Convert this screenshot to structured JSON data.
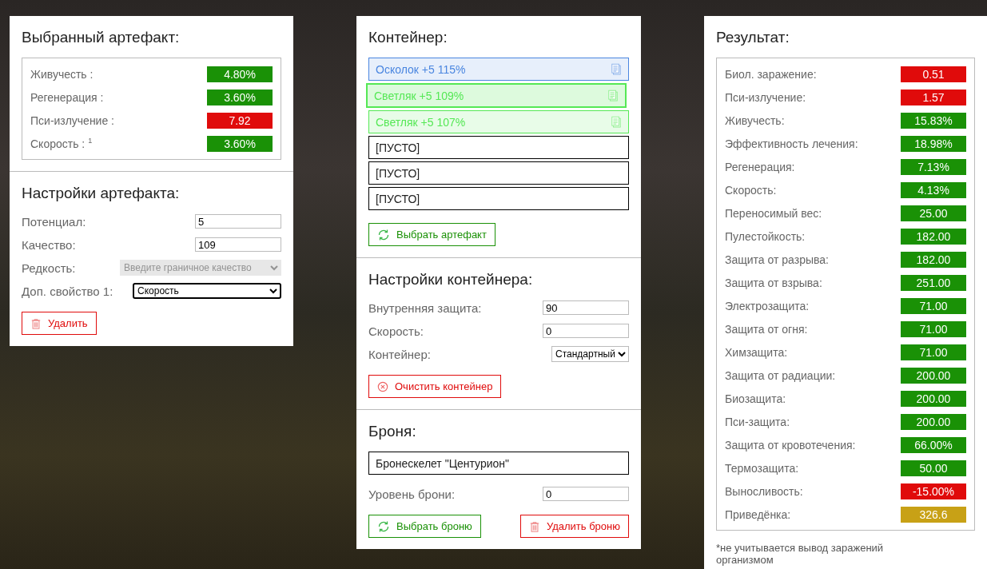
{
  "artifact": {
    "title": "Выбранный артефакт:",
    "stats": [
      {
        "label": "Живучесть :",
        "value": "4.80%",
        "color": "#1a9106"
      },
      {
        "label": "Регенерация :",
        "value": "3.60%",
        "color": "#1a9106"
      },
      {
        "label": "Пси-излучение :",
        "value": "7.92",
        "color": "#e00b0b"
      },
      {
        "label": "Скорость : $^{1}$",
        "value": "3.60%",
        "color": "#1a9106"
      }
    ]
  },
  "artifact_settings": {
    "title": "Настройки артефакта:",
    "fields": [
      {
        "kind": "input",
        "label": "Потенциал:",
        "value": "5"
      },
      {
        "kind": "input",
        "label": "Качество:",
        "value": "109"
      },
      {
        "kind": "select",
        "label": "Редкость:",
        "value": "Введите граничное качество",
        "disabled": true
      },
      {
        "kind": "select",
        "label": "Доп. свойство 1:",
        "value": "Скорость",
        "disabled": false
      }
    ],
    "buttons": [
      {
        "kind": "delete",
        "label": "Удалить"
      }
    ]
  },
  "container": {
    "title": "Контейнер:",
    "slots": [
      {
        "kind": "artifact",
        "label": "Осколок +5 115%",
        "color": "#4a86e0",
        "selected": false
      },
      {
        "kind": "artifact",
        "label": "Светляк +5 109%",
        "color": "#55e855",
        "selected": true
      },
      {
        "kind": "artifact",
        "label": "Светляк +5 107%",
        "color": "#55e855",
        "selected": false
      },
      {
        "kind": "empty",
        "label": "[ПУСТО]",
        "selected": false
      },
      {
        "kind": "empty",
        "label": "[ПУСТО]",
        "selected": false
      },
      {
        "kind": "empty",
        "label": "[ПУСТО]",
        "selected": false
      }
    ],
    "buttons": [
      {
        "kind": "choose",
        "label": "Выбрать артефакт"
      }
    ]
  },
  "container_settings": {
    "title": "Настройки контейнера:",
    "fields": [
      {
        "kind": "input",
        "label": "Внутренняя защита:",
        "value": "90"
      },
      {
        "kind": "input",
        "label": "Скорость:",
        "value": "0"
      },
      {
        "kind": "select",
        "label": "Контейнер:",
        "value": "Стандартный",
        "disabled": false
      }
    ],
    "buttons": [
      {
        "kind": "clear",
        "label": "Очистить контейнер"
      }
    ]
  },
  "armor": {
    "title": "Броня:",
    "name": "Бронескелет \"Центурион\"",
    "fields": [
      {
        "kind": "input",
        "label": "Уровень брони:",
        "value": "0"
      }
    ],
    "buttons": [
      {
        "kind": "choose",
        "label": "Выбрать броню"
      },
      {
        "kind": "delete",
        "label": "Удалить броню"
      }
    ]
  },
  "result": {
    "title": "Результат:",
    "stats": [
      {
        "label": "Биол. заражение:",
        "value": "0.51",
        "color": "#e00b0b"
      },
      {
        "label": "Пси-излучение:",
        "value": "1.57",
        "color": "#e00b0b"
      },
      {
        "label": "Живучесть:",
        "value": "15.83%",
        "color": "#1a9106"
      },
      {
        "label": "Эффективность лечения:",
        "value": "18.98%",
        "color": "#1a9106"
      },
      {
        "label": "Регенерация:",
        "value": "7.13%",
        "color": "#1a9106"
      },
      {
        "label": "Скорость:",
        "value": "4.13%",
        "color": "#1a9106"
      },
      {
        "label": "Переносимый вес:",
        "value": "25.00",
        "color": "#1a9106"
      },
      {
        "label": "Пулестойкость:",
        "value": "182.00",
        "color": "#1a9106"
      },
      {
        "label": "Защита от разрыва:",
        "value": "182.00",
        "color": "#1a9106"
      },
      {
        "label": "Защита от взрыва:",
        "value": "251.00",
        "color": "#1a9106"
      },
      {
        "label": "Электрозащита:",
        "value": "71.00",
        "color": "#1a9106"
      },
      {
        "label": "Защита от огня:",
        "value": "71.00",
        "color": "#1a9106"
      },
      {
        "label": "Химзащита:",
        "value": "71.00",
        "color": "#1a9106"
      },
      {
        "label": "Защита от радиации:",
        "value": "200.00",
        "color": "#1a9106"
      },
      {
        "label": "Биозащита:",
        "value": "200.00",
        "color": "#1a9106"
      },
      {
        "label": "Пси-защита:",
        "value": "200.00",
        "color": "#1a9106"
      },
      {
        "label": "Защита от кровотечения:",
        "value": "66.00%",
        "color": "#1a9106"
      },
      {
        "label": "Термозащита:",
        "value": "50.00",
        "color": "#1a9106"
      },
      {
        "label": "Выносливость:",
        "value": "-15.00%",
        "color": "#e00b0b"
      },
      {
        "label": "Приведёнка:",
        "value": "326.6",
        "color": "#c8a116"
      }
    ],
    "note": "*не учитывается вывод заражений организмом"
  }
}
